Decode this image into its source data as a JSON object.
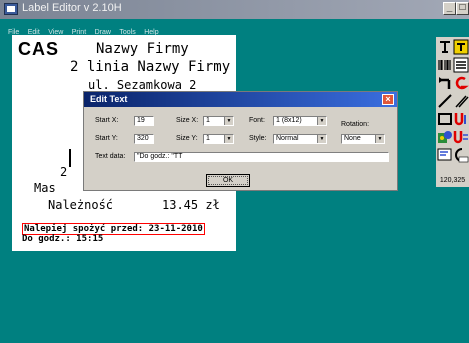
{
  "window": {
    "title": "Label Editor v 2.10H",
    "min_glyph": "_",
    "max_glyph": "□"
  },
  "menu": [
    "File",
    "Edit",
    "View",
    "Print",
    "Draw",
    "Tools",
    "Help"
  ],
  "canvas": {
    "logo": "CAS",
    "lines": [
      "Nazwy Firmy",
      "2 linia Nazwy Firmy",
      "ul. Sezamkowa 2",
      "2",
      "Mas",
      "Należność",
      "13.45 zł",
      "Nalepiej spożyć przed: 23-11-2010",
      "Do godz.: 15:15"
    ]
  },
  "toolbox": {
    "coords": "120,325"
  },
  "dialog": {
    "title": "Edit Text",
    "close_glyph": "×",
    "labels": {
      "start_x": "Start X:",
      "start_y": "Start Y:",
      "size_x": "Size X:",
      "size_y": "Size Y:",
      "font": "Font:",
      "style": "Style:",
      "rotation": "Rotation:",
      "text_data": "Text data:"
    },
    "values": {
      "start_x": "19",
      "start_y": "320",
      "size_x": "1",
      "size_y": "1",
      "font": "1 (8x12)",
      "style": "Normal",
      "rotation": "None",
      "text_data": "\"Do godz.: \"TT"
    },
    "arrow_glyph": "▼",
    "ok": "OK"
  }
}
